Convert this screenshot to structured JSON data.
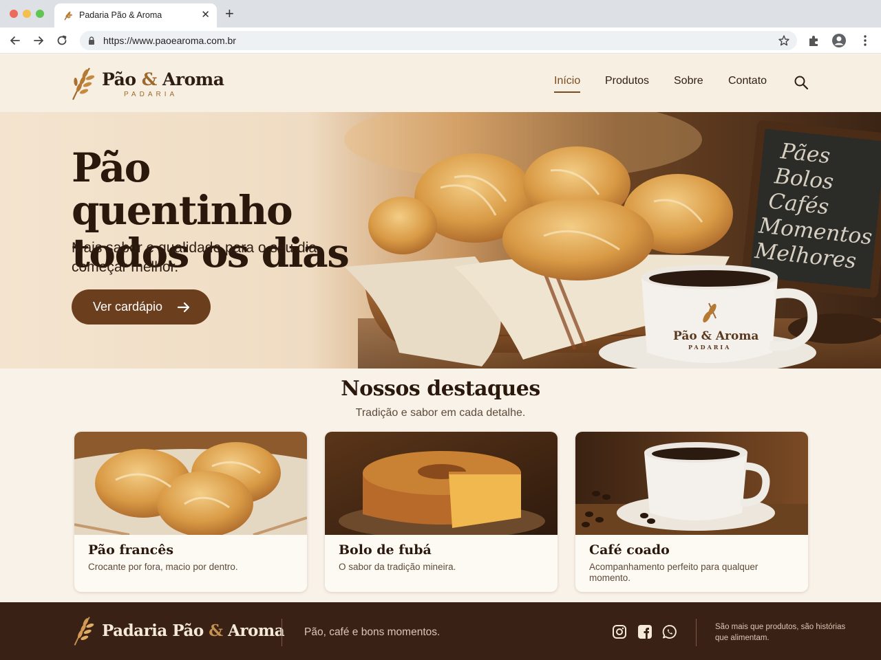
{
  "browser": {
    "tab_title": "Padaria Pão & Aroma",
    "url": "https://www.paoearoma.com.br"
  },
  "header": {
    "logo_name": "Pão",
    "logo_amp": "&",
    "logo_name2": "Aroma",
    "logo_subtitle": "PADARIA",
    "nav": [
      "Início",
      "Produtos",
      "Sobre",
      "Contato"
    ],
    "active_nav": "Início"
  },
  "hero": {
    "title_line1": "Pão quentinho",
    "title_line2": "todos os dias",
    "subtitle": "Mais sabor e qualidade para o seu dia começar melhor.",
    "cta_label": "Ver cardápio",
    "chalkboard": [
      "Pães",
      "Bolos",
      "Cafés",
      "Momentos",
      "Melhores"
    ],
    "mug_brand": "Pão & Aroma",
    "mug_sub": "PADARIA"
  },
  "highlights": {
    "title": "Nossos destaques",
    "subtitle": "Tradição e sabor em cada detalhe.",
    "cards": [
      {
        "title": "Pão francês",
        "description": "Crocante por fora, macio por dentro.",
        "image": "bread-basket-photo"
      },
      {
        "title": "Bolo de fubá",
        "description": "O sabor da tradição mineira.",
        "image": "corn-cake-photo"
      },
      {
        "title": "Café coado",
        "description": "Acompanhamento perfeito para qualquer momento.",
        "image": "coffee-cup-photo"
      }
    ]
  },
  "footer": {
    "brand_prefix": "Padaria Pão",
    "brand_amp": "&",
    "brand_suffix": "Aroma",
    "tagline": "Pão, café e bons momentos.",
    "note": "São mais que produtos, são histórias que alimentam.",
    "social": [
      "instagram-icon",
      "facebook-icon",
      "whatsapp-icon"
    ]
  },
  "colors": {
    "brand_brown": "#6b3e1d",
    "accent_gold": "#9c6a2f",
    "footer_bg": "#3a2116",
    "page_bg": "#f9f2e8"
  }
}
